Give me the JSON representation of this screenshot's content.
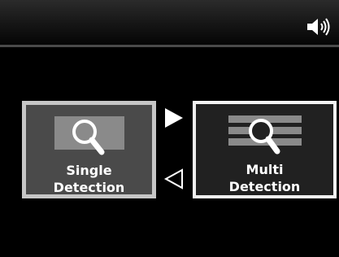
{
  "status_bar": {
    "sound_icon": "speaker-volume-icon"
  },
  "modes": [
    {
      "id": "single",
      "label_line1": "Single",
      "label_line2": "Detection",
      "icon": "magnifier-icon",
      "selected": false
    },
    {
      "id": "multi",
      "label_line1": "Multi",
      "label_line2": "Detection",
      "icon": "multi-line-magnifier-icon",
      "selected": true
    }
  ],
  "navigation": {
    "right_arrow_icon": "right-arrow-filled-icon",
    "left_arrow_icon": "left-arrow-outline-icon"
  },
  "colors": {
    "background": "#000000",
    "selected_border": "#f2f2f2",
    "unselected_border": "#c6c6c6",
    "icon_fill": "#8a8a8a"
  }
}
